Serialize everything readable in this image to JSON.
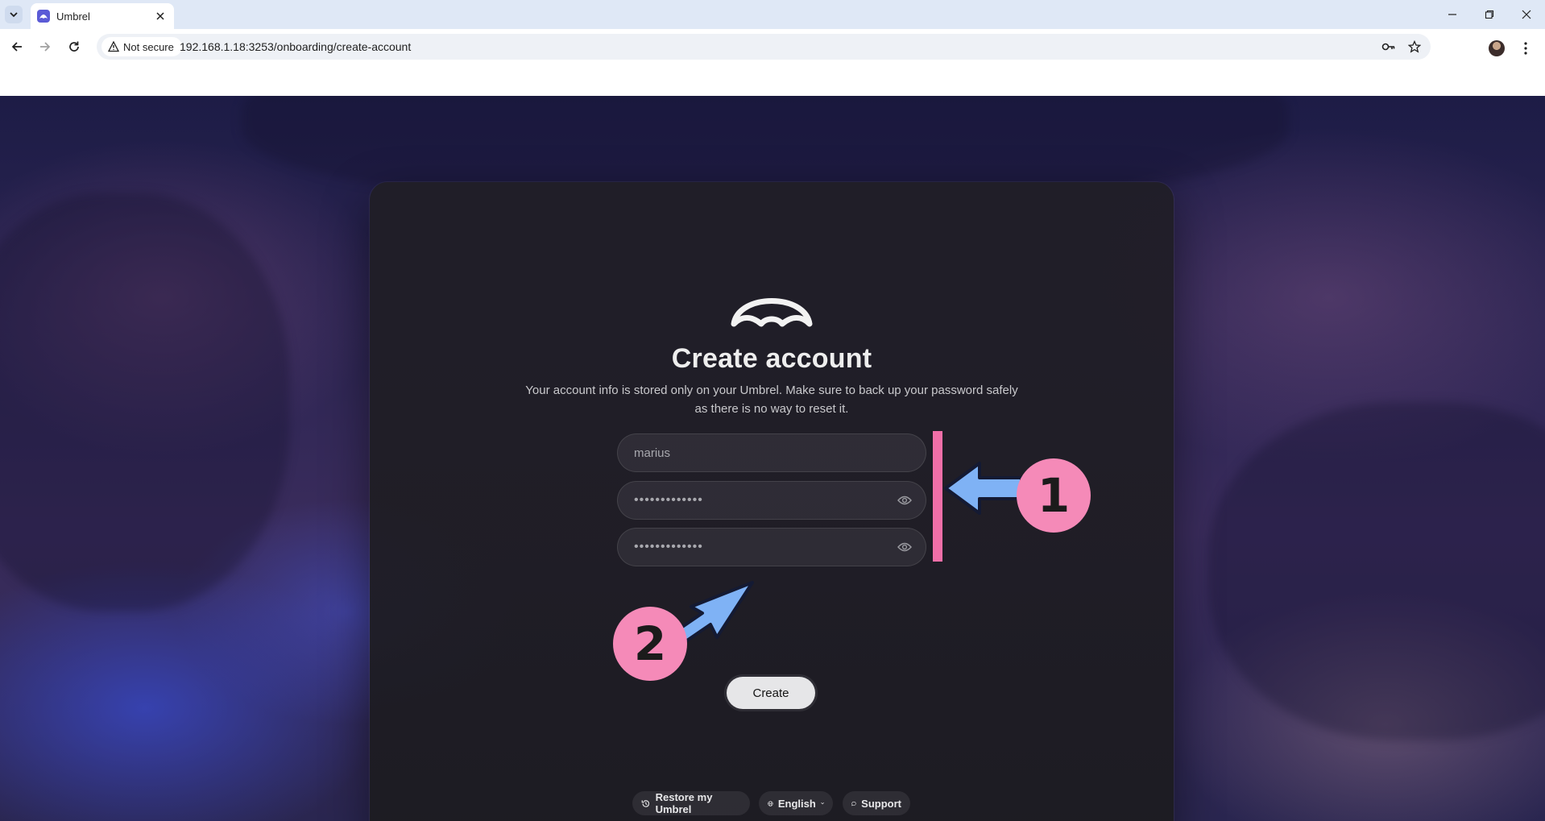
{
  "browser": {
    "tab_title": "Umbrel",
    "security_label": "Not secure",
    "url": "192.168.1.18:3253/onboarding/create-account"
  },
  "onboarding": {
    "title": "Create account",
    "subtitle": "Your account info is stored only on your Umbrel. Make sure to back up your password safely as there is no way to reset it.",
    "name_value": "marius",
    "password_value": "•••••••••••••",
    "confirm_password_value": "•••••••••••••",
    "create_label": "Create"
  },
  "footer": {
    "restore_label": "Restore my Umbrel",
    "language_label": "English",
    "support_label": "Support"
  },
  "annotations": {
    "step1": "1",
    "step2": "2",
    "highlight_color": "#f06fa8",
    "badge_color": "#f58ab8",
    "arrow_color": "#7fb2f5"
  }
}
